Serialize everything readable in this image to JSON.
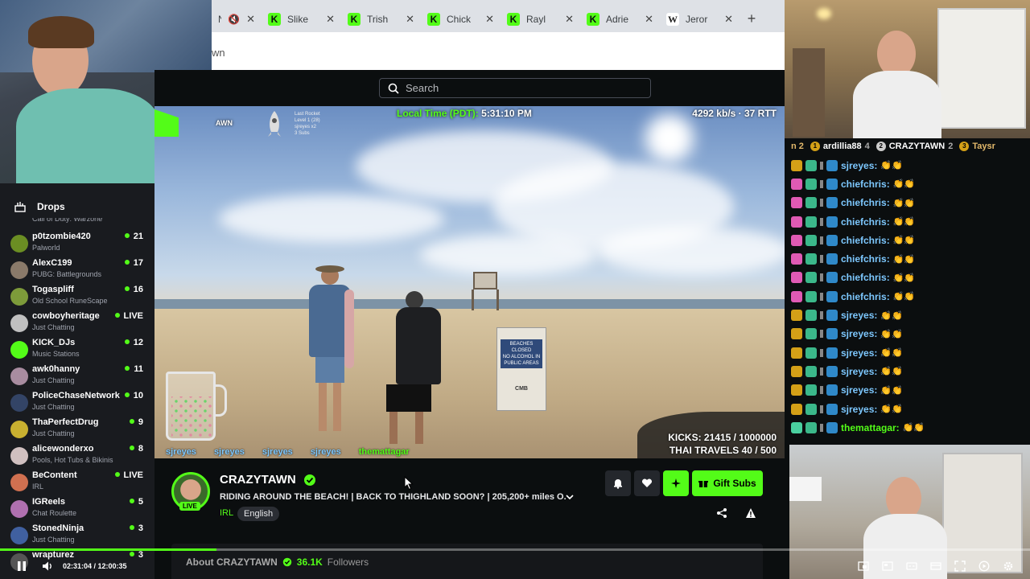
{
  "tabs": [
    {
      "label": "N",
      "icon": "mute-icon",
      "kind": "kick"
    },
    {
      "label": "Slike",
      "kind": "kick"
    },
    {
      "label": "Trish",
      "kind": "kick"
    },
    {
      "label": "Chick",
      "kind": "kick"
    },
    {
      "label": "Rayl",
      "kind": "kick"
    },
    {
      "label": "Adrie",
      "kind": "kick"
    },
    {
      "label": "Jeror",
      "kind": "wiki"
    }
  ],
  "url": "wn",
  "search": {
    "placeholder": "Search"
  },
  "overlay": {
    "local_time_label": "Local Time (PDT):",
    "local_time": "5:31:10 PM",
    "bitrate": "4292 kb/s · 37 RTT",
    "top_left_logo": "AWN",
    "rocket": {
      "title": "Last Rocket",
      "lines": [
        "Level 1 (28)",
        "sjreyes x2",
        "3 Subs"
      ]
    },
    "kicks": "KICKS: 21415 / 1000000",
    "thai_travels": "THAI TRAVELS 40 / 500",
    "ticker": [
      "sjreyes",
      "sjreyes",
      "sjreyes",
      "sjreyes",
      "themattagar"
    ],
    "sign_text": [
      "BEACHES",
      "CLOSED",
      "NO ALCOHOL IN",
      "PUBLIC AREAS"
    ],
    "sign_bottom": "CMB"
  },
  "sidebar": {
    "drops_label": "Drops",
    "truncated_top": "Call of Duty: Warzone",
    "channels": [
      {
        "name": "p0tzombie420",
        "category": "Palworld",
        "count": "21",
        "color": "#6b8e23"
      },
      {
        "name": "AlexC199",
        "category": "PUBG: Battlegrounds",
        "count": "17",
        "color": "#8a7a6a"
      },
      {
        "name": "Togaspliff",
        "category": "Old School RuneScape",
        "count": "16",
        "color": "#7d9b3a"
      },
      {
        "name": "cowboyheritage",
        "category": "Just Chatting",
        "count": "LIVE",
        "color": "#c0c0c0"
      },
      {
        "name": "KICK_DJs",
        "category": "Music Stations",
        "count": "12",
        "color": "#53fc18"
      },
      {
        "name": "awk0hanny",
        "category": "Just Chatting",
        "count": "11",
        "color": "#a88ca0"
      },
      {
        "name": "PoliceChaseNetwork",
        "category": "Just Chatting",
        "count": "10",
        "color": "#334466"
      },
      {
        "name": "ThaPerfectDrug",
        "category": "Just Chatting",
        "count": "9",
        "color": "#c8b030"
      },
      {
        "name": "alicewonderxo",
        "category": "Pools, Hot Tubs & Bikinis",
        "count": "8",
        "color": "#d0c0c0"
      },
      {
        "name": "BeContent",
        "category": "IRL",
        "count": "LIVE",
        "color": "#d07050"
      },
      {
        "name": "IGReels",
        "category": "Chat Roulette",
        "count": "5",
        "color": "#b070b0"
      },
      {
        "name": "StonedNinja",
        "category": "Just Chatting",
        "count": "3",
        "color": "#4060a0"
      },
      {
        "name": "wrapturez",
        "category": "",
        "count": "3",
        "color": "#555"
      }
    ]
  },
  "stream": {
    "channel": "CRAZYTAWN",
    "title": "RIDING AROUND THE BEACH! | BACK TO THIGHLAND SOON? | 205,200+ miles O...",
    "category": "IRL",
    "language": "English",
    "live_badge": "LIVE",
    "gift_label": "Gift Subs",
    "about_label": "About CRAZYTAWN",
    "followers": "36.1K",
    "followers_label": "Followers"
  },
  "chat": {
    "top": [
      {
        "rank": "",
        "name": "n 2"
      },
      {
        "rank": "1",
        "name": "ardillia88",
        "count": "4"
      },
      {
        "rank": "2",
        "name": "CRAZYTAWN",
        "count": "2"
      },
      {
        "rank": "3",
        "name": "Taysr"
      }
    ],
    "messages": [
      {
        "user": "sjreyes:",
        "badge": "#d4a017",
        "color": "#7dc8ff"
      },
      {
        "user": "chiefchris:",
        "badge": "#e05ab4",
        "color": "#7dc8ff"
      },
      {
        "user": "chiefchris:",
        "badge": "#e05ab4",
        "color": "#7dc8ff"
      },
      {
        "user": "chiefchris:",
        "badge": "#e05ab4",
        "color": "#7dc8ff"
      },
      {
        "user": "chiefchris:",
        "badge": "#e05ab4",
        "color": "#7dc8ff"
      },
      {
        "user": "chiefchris:",
        "badge": "#e05ab4",
        "color": "#7dc8ff"
      },
      {
        "user": "chiefchris:",
        "badge": "#e05ab4",
        "color": "#7dc8ff"
      },
      {
        "user": "chiefchris:",
        "badge": "#e05ab4",
        "color": "#7dc8ff"
      },
      {
        "user": "sjreyes:",
        "badge": "#d4a017",
        "color": "#7dc8ff"
      },
      {
        "user": "sjreyes:",
        "badge": "#d4a017",
        "color": "#7dc8ff"
      },
      {
        "user": "sjreyes:",
        "badge": "#d4a017",
        "color": "#7dc8ff"
      },
      {
        "user": "sjreyes:",
        "badge": "#d4a017",
        "color": "#7dc8ff"
      },
      {
        "user": "sjreyes:",
        "badge": "#d4a017",
        "color": "#7dc8ff"
      },
      {
        "user": "sjreyes:",
        "badge": "#d4a017",
        "color": "#7dc8ff"
      },
      {
        "user": "themattagar:",
        "badge": "#4ad0a0",
        "color": "#53fc18"
      }
    ],
    "emote": "👏👏"
  },
  "player": {
    "time": "02:31:04 / 12:00:35",
    "progress": 0.21
  },
  "colors": {
    "accent": "#53fc18",
    "bg": "#0b0e0f"
  }
}
